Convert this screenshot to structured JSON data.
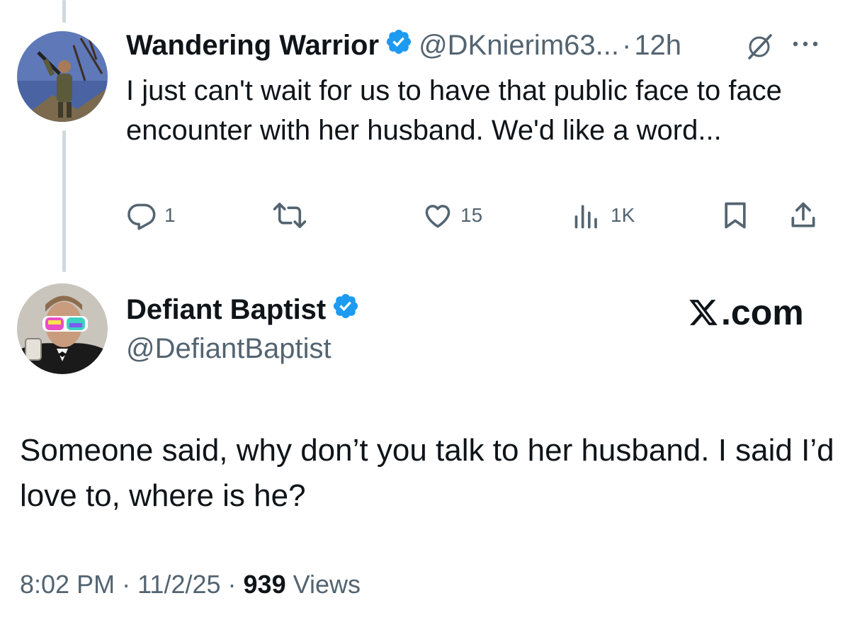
{
  "parent_tweet": {
    "author_name": "Wandering Warrior",
    "handle": "@DKnierim63...",
    "separator": "·",
    "time": "12h",
    "text": "I just can't wait for us to have that public face to face encounter with her husband. We'd like a word...",
    "actions": {
      "reply_count": "1",
      "retweet_count": "",
      "like_count": "15",
      "views_count": "1K"
    }
  },
  "main_tweet": {
    "author_name": "Defiant Baptist",
    "handle": "@DefiantBaptist",
    "brand": ".com",
    "text": "Someone said, why don’t you talk to her husband. I said I’d love to, where is he?",
    "meta": {
      "time": "8:02 PM",
      "sep1": " · ",
      "date": "11/2/25",
      "sep2": " · ",
      "views": "939",
      "views_label": " Views"
    }
  },
  "colors": {
    "verified": "#1d9bf0",
    "muted": "#536471",
    "text": "#0f1419",
    "thread": "#cfd9de"
  }
}
